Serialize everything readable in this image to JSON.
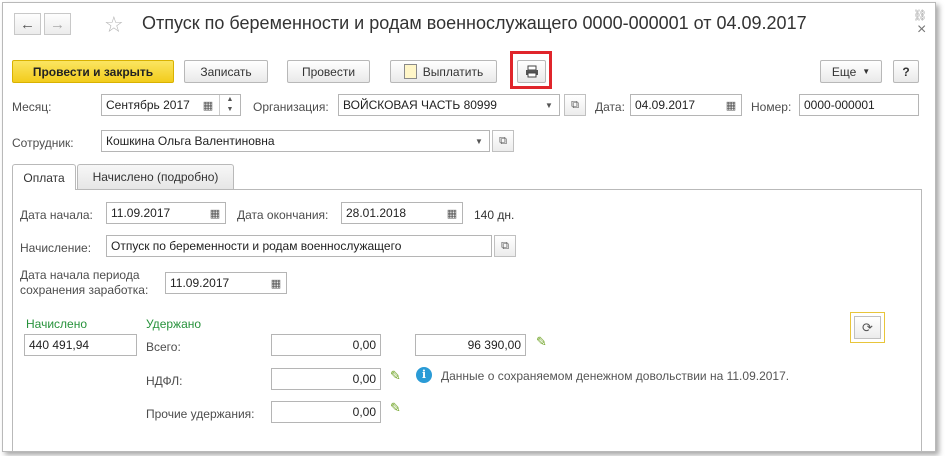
{
  "window": {
    "title": "Отпуск по беременности и родам военнослужащего 0000-000001 от 04.09.2017",
    "close_symbol": "×",
    "link_symbol": "⛓"
  },
  "toolbar": {
    "post_close_label": "Провести и закрыть",
    "save_label": "Записать",
    "post_label": "Провести",
    "pay_label": "Выплатить",
    "more_label": "Еще",
    "help_label": "?"
  },
  "header": {
    "month_label": "Месяц:",
    "month_value": "Сентябрь 2017",
    "org_label": "Организация:",
    "org_value": "ВОЙСКОВАЯ ЧАСТЬ 80999",
    "date_label": "Дата:",
    "date_value": "04.09.2017",
    "number_label": "Номер:",
    "number_value": "0000-000001",
    "employee_label": "Сотрудник:",
    "employee_value": "Кошкина Ольга Валентиновна"
  },
  "tabs": [
    {
      "label": "Оплата"
    },
    {
      "label": "Начислено (подробно)"
    }
  ],
  "payment": {
    "start_label": "Дата начала:",
    "start_value": "11.09.2017",
    "end_label": "Дата окончания:",
    "end_value": "28.01.2018",
    "days": "140 дн.",
    "accrual_label": "Начисление:",
    "accrual_value": "Отпуск по беременности и родам военнослужащего",
    "period_label_1": "Дата начала периода",
    "period_label_2": "сохранения заработка:",
    "period_value": "11.09.2017",
    "accrued_header": "Начислено",
    "withheld_header": "Удержано",
    "accrued_value": "440 491,94",
    "total_label": "Всего:",
    "total_value": "0,00",
    "pay_value": "96 390,00",
    "ndfl_label": "НДФЛ:",
    "ndfl_value": "0,00",
    "other_label": "Прочие удержания:",
    "other_value": "0,00",
    "info_text": "Данные о сохраняемом денежном довольствии на 11.09.2017."
  },
  "colors": {
    "primary_button": "#f2cc1c",
    "highlight_frame": "#e0252b",
    "green_header": "#27923b",
    "info_icon": "#2a9bd6"
  }
}
